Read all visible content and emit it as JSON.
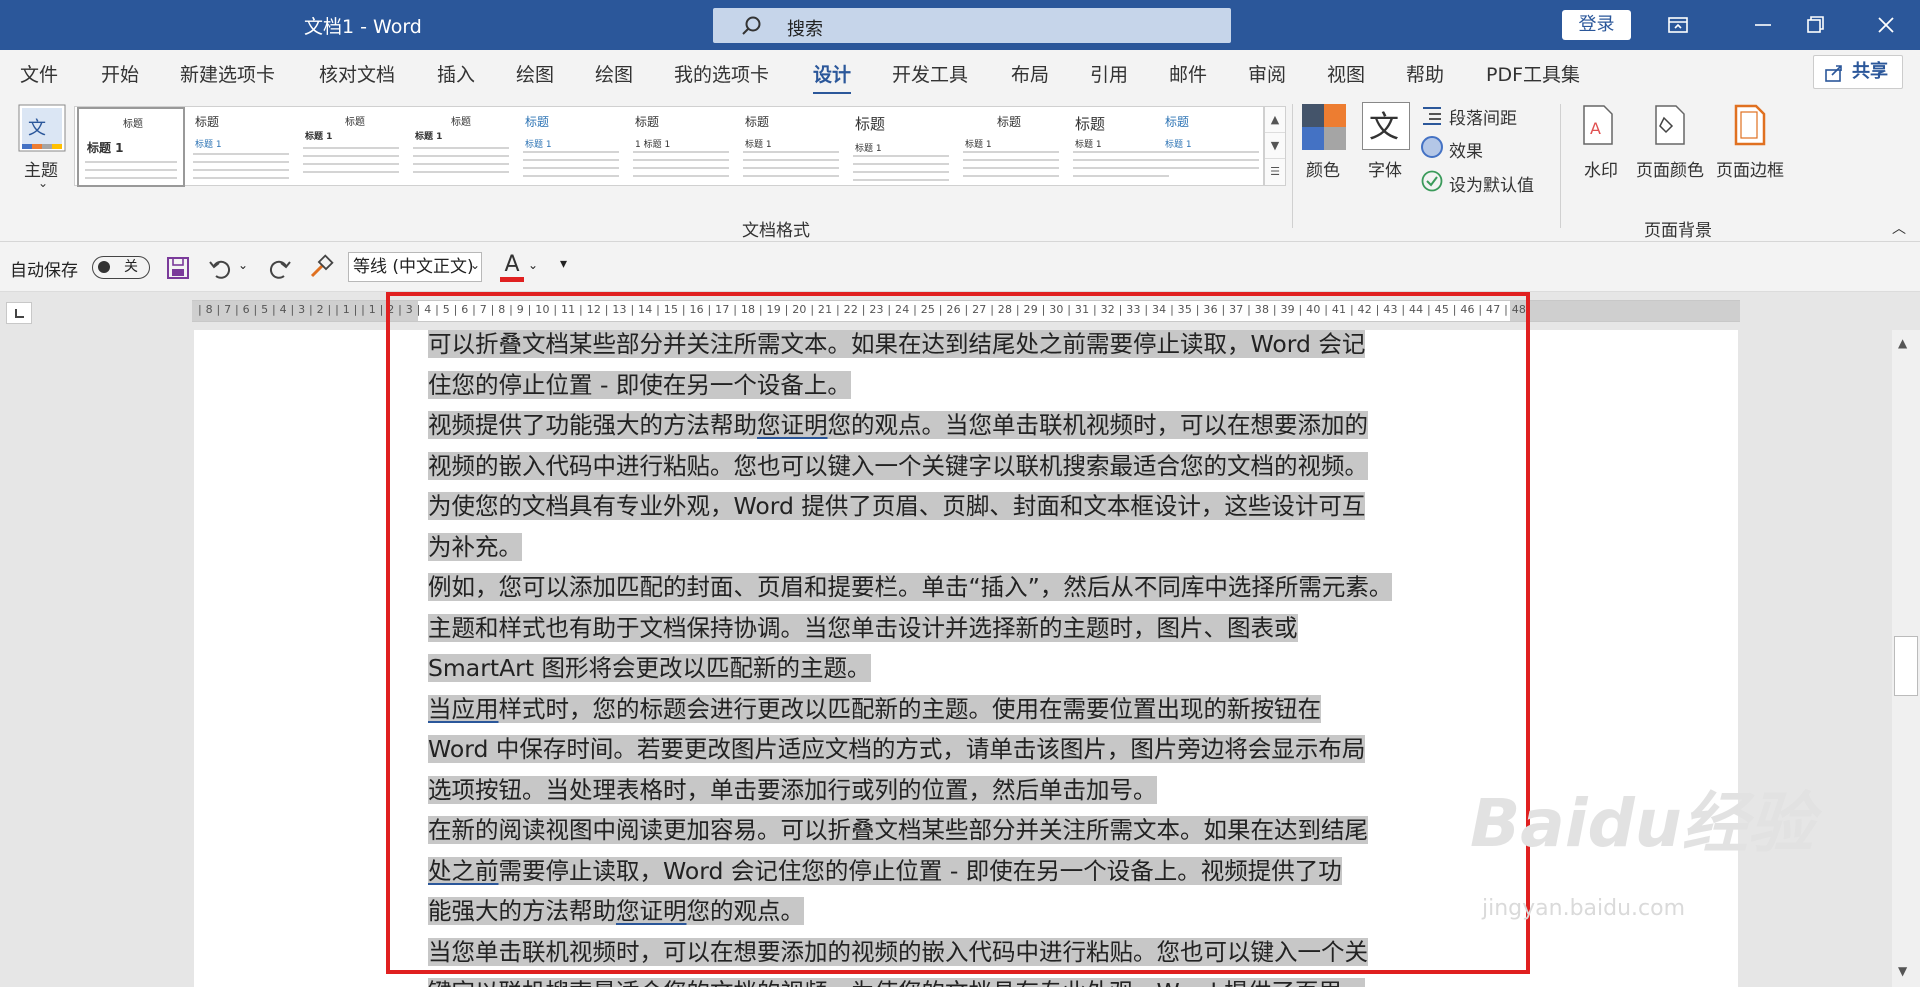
{
  "titlebar": {
    "title": "文档1  -  Word",
    "search_placeholder": "搜索",
    "login_label": "登录"
  },
  "tabs": [
    "文件",
    "开始",
    "新建选项卡",
    "核对文档",
    "插入",
    "绘图",
    "绘图",
    "我的选项卡",
    "设计",
    "开发工具",
    "布局",
    "引用",
    "邮件",
    "审阅",
    "视图",
    "帮助",
    "PDF工具集"
  ],
  "active_tab": "设计",
  "share_label": "共享",
  "ribbon": {
    "theme_label": "主题",
    "gallery": {
      "item0": {
        "h1": "标题",
        "h2": "标题 1"
      },
      "item1": {
        "h1": "标题",
        "h2": "标题 1",
        "text": "对于'插入'选项卡上的库，在设计时都应当慎重考虑"
      },
      "item2": {
        "h1": "标题",
        "h2": "标题 1",
        "text": "对于'插入'选项卡上的库，在设计时都应当慎重考虑"
      },
      "item3": {
        "h1": "标题",
        "h2": "标题 1",
        "text": "对于'插入'选项卡上的库，在设计时都应当慎重考虑"
      },
      "item4": {
        "h1": "标题",
        "h2": "标题 1",
        "text": "对于'插入'选项卡上的库，在设计时都应当慎重考虑"
      },
      "item5": {
        "h1": "标题",
        "h2": "1 标题 1",
        "text": "对于'插入'选项卡上的库，在设计时都应当慎重考虑"
      },
      "item6": {
        "h1": "标题",
        "h2": "标题 1",
        "text": "对于'插入'选项卡上的库，在设计时都应当慎重考虑"
      },
      "item7": {
        "h1": "标题",
        "h2": "标题 1",
        "text": "对于'插入'选项卡上的库，在设计时都应当慎重考虑"
      },
      "item8": {
        "h1": "标题",
        "h2": "标题 1",
        "text": "对于'插入'选项卡上的库，在设计时都应当慎重考虑"
      },
      "item9": {
        "h1": "标题",
        "h2": "标题 1",
        "text": "对于'插入'选项卡上的库，在设计时都应当慎重考虑"
      },
      "item10": {
        "h1": "标题",
        "h2": "标题 1",
        "text": "对于'插入'选项卡上的库，在设计时都应当慎重考虑"
      }
    },
    "group_doc_format": "文档格式",
    "colors_label": "颜色",
    "fonts_label": "字体",
    "para_spacing": "段落间距",
    "effects": "效果",
    "set_default": "设为默认值",
    "watermark": "水印",
    "page_color": "页面颜色",
    "page_border": "页面边框",
    "group_page_bg": "页面背景"
  },
  "qat": {
    "autosave_label": "自动保存",
    "autosave_state": "关",
    "font_name": "等线 (中文正文)",
    "font_color_letter": "A"
  },
  "ruler_ticks": "| 8 | 7 | 6 | 5 | 4 | 3 | 2 |   | 1 |   | 1 | 2 | 3 | 4 | 5 | 6 | 7 | 8 | 9 | 10 | 11 | 12 | 13 | 14 | 15 | 16 | 17 | 18 | 19 | 20 | 21 | 22 | 23 | 24 | 25 | 26 | 27 | 28 | 29 | 30 | 31 | 32 | 33 | 34 | 35 | 36 | 37 | 38 | 39 |   40 | 41 | 42 | 43 | 44 | 45 | 46 | 47 | 48",
  "document": {
    "l01": "可以折叠文档某些部分并关注所需文本。如果在达到结尾处之前需要停止读取，Word 会记",
    "l02": "住您的停止位置 - 即使在另一个设备上。",
    "l03a": "视频提供了功能强大的方法帮助",
    "l03u": "您证明",
    "l03b": "您的观点。当您单击联机视频时，可以在想要添加的",
    "l04": "视频的嵌入代码中进行粘贴。您也可以键入一个关键字以联机搜索最适合您的文档的视频。",
    "l05": "为使您的文档具有专业外观，Word 提供了页眉、页脚、封面和文本框设计，这些设计可互",
    "l06": "为补充。",
    "l07": "例如，您可以添加匹配的封面、页眉和提要栏。单击“插入”，然后从不同库中选择所需元素。",
    "l08": "主题和样式也有助于文档保持协调。当您单击设计并选择新的主题时，图片、图表或",
    "l09": "SmartArt 图形将会更改以匹配新的主题。",
    "l10u": "当应用",
    "l10b": "样式时，您的标题会进行更改以匹配新的主题。使用在需要位置出现的新按钮在",
    "l11": "Word 中保存时间。若要更改图片适应文档的方式，请单击该图片，图片旁边将会显示布局",
    "l12": "选项按钮。当处理表格时，单击要添加行或列的位置，然后单击加号。",
    "l13": "在新的阅读视图中阅读更加容易。可以折叠文档某些部分并关注所需文本。如果在达到结尾",
    "l14u": "处之前",
    "l14b": "需要停止读取，Word 会记住您的停止位置 - 即使在另一个设备上。视频提供了功",
    "l15a": "能强大的方法帮助",
    "l15u": "您证明",
    "l15b": "您的观点。",
    "l16": "当您单击联机视频时，可以在想要添加的视频的嵌入代码中进行粘贴。您也可以键入一个关",
    "l17": "键字以联机搜索最适合您的文档的视频。为使您的文档具有专业外观，Word 提供了页眉、"
  },
  "watermark": {
    "brand": "Baidu经验",
    "url": "jingyan.baidu.com"
  }
}
